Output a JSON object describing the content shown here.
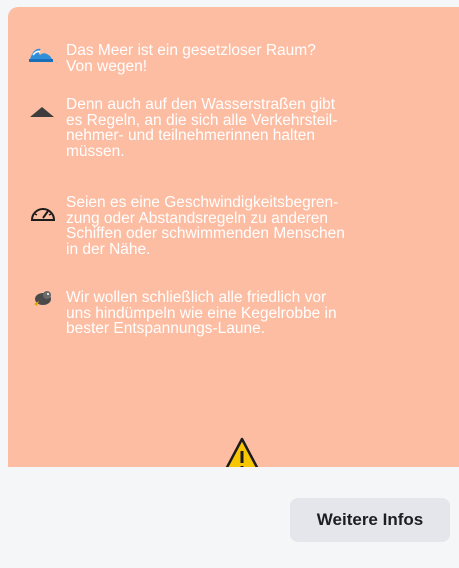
{
  "post": {
    "background_color": "#fdbda3",
    "text_color": "#ffffff",
    "items": [
      {
        "icon": "ocean-wave-icon",
        "text": "Das Meer ist ein gesetzloser Raum?\nVon wegen!"
      },
      {
        "icon": "triangle-up-icon",
        "text": "Denn auch auf den Wasserstraßen gibt\nes Regeln, an die sich alle Verkehrsteil-\nnehmer- und teilnehmerinnen halten\nmüssen."
      },
      {
        "icon": "speedometer-icon",
        "text": "Seien es eine Geschwindigkeitsbegren-\nzung oder Abstandsregeln zu anderen\nSchiffen oder schwimmenden Menschen\nin der Nähe."
      },
      {
        "icon": "seal-icon",
        "text": "Wir wollen schließlich alle friedlich vor\nuns hindümpeln wie eine Kegelrobbe in\nbester Entspannungs-Laune."
      }
    ],
    "footer_icon": "warning-sign-icon"
  },
  "actions": {
    "more_info_label": "Weitere Infos"
  }
}
